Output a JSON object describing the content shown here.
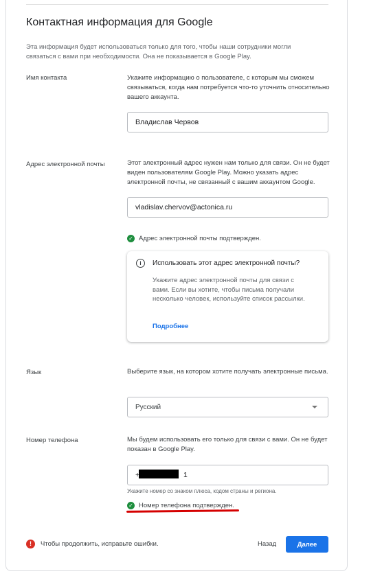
{
  "section": {
    "title": "Контактная информация для Google",
    "intro": "Эта информация будет использоваться только для того, чтобы наши сотрудники могли связаться с вами при необходимости. Она не показывается в Google Play."
  },
  "contact_name": {
    "label": "Имя контакта",
    "description": "Укажите информацию о пользователе, с которым мы сможем связываться, когда нам потребуется что-то уточнить относительно вашего аккаунта.",
    "value": "Владислав Червов"
  },
  "email": {
    "label": "Адрес электронной почты",
    "description": "Этот электронный адрес нужен нам только для связи. Он не будет виден пользователям Google Play. Можно указать адрес электронной почты, не связанный с вашим аккаунтом Google.",
    "value": "vladislav.chervov@actonica.ru",
    "status": "Адрес электронной почты подтвержден.",
    "info": {
      "title": "Использовать этот адрес электронной почты?",
      "body": "Укажите адрес электронной почты для связи с вами. Если вы хотите, чтобы письма получали несколько человек, используйте список рассылки.",
      "link": "Подробнее"
    }
  },
  "language": {
    "label": "Язык",
    "description": "Выберите язык, на котором хотите получать электронные письма.",
    "selected": "Русский"
  },
  "phone": {
    "label": "Номер телефона",
    "description": "Мы будем использовать его только для связи с вами. Он не будет показан в Google Play.",
    "value_prefix": "+7",
    "value_suffix": "1",
    "hint": "Укажите номер со знаком плюса, кодом страны и региона.",
    "status": "Номер телефона подтвержден."
  },
  "footer": {
    "error": "Чтобы продолжить, исправьте ошибки.",
    "back": "Назад",
    "next": "Далее"
  },
  "colors": {
    "accent": "#1a73e8",
    "success": "#1e8e3e",
    "error": "#d93025",
    "annotation": "#d50000"
  }
}
